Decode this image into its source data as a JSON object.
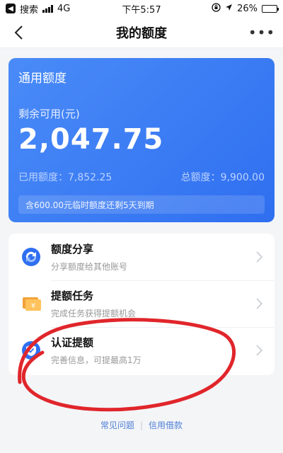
{
  "status_bar": {
    "carrier": "搜索",
    "network": "4G",
    "time": "下午5:57",
    "battery": "26%",
    "battery_level": 0.26
  },
  "nav": {
    "title": "我的额度",
    "more": "•••"
  },
  "card": {
    "title": "通用额度",
    "available_label": "剩余可用(元)",
    "available_amount": "2,047.75",
    "used_label": "已用额度：",
    "used_value": "7,852.25",
    "total_label": "总额度：",
    "total_value": "9,900.00",
    "notice": "含600.00元临时额度还剩5天到期",
    "color": "#3a7cf5"
  },
  "items": [
    {
      "title": "额度分享",
      "desc": "分享额度给其他账号",
      "icon": "share-quota-icon"
    },
    {
      "title": "提额任务",
      "desc": "完成任务获得提额机会",
      "icon": "task-icon"
    },
    {
      "title": "认证提额",
      "desc": "完善信息，可提最高1万",
      "icon": "verify-icon"
    }
  ],
  "footer": {
    "faq": "常见问题",
    "loan": "信用借款"
  },
  "annotation_color": "#e0262b"
}
